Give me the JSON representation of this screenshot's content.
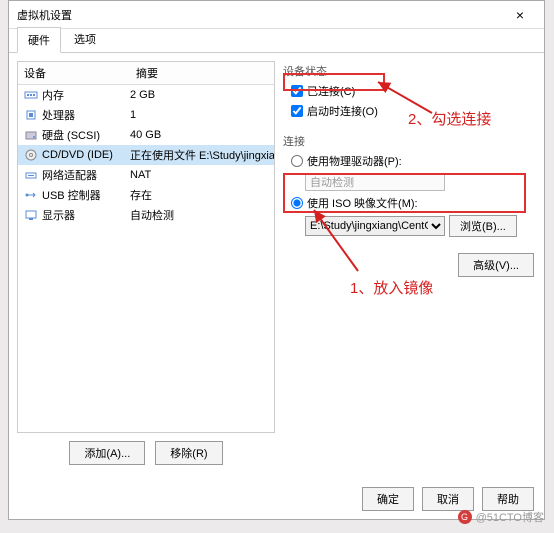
{
  "window": {
    "title": "虚拟机设置",
    "close": "×"
  },
  "tabs": {
    "hardware": "硬件",
    "options": "选项"
  },
  "table": {
    "col_device": "设备",
    "col_summary": "摘要",
    "rows": [
      {
        "name": "内存",
        "val": "2 GB"
      },
      {
        "name": "处理器",
        "val": "1"
      },
      {
        "name": "硬盘 (SCSI)",
        "val": "40 GB"
      },
      {
        "name": "CD/DVD (IDE)",
        "val": "正在使用文件 E:\\Study\\jingxian..."
      },
      {
        "name": "网络适配器",
        "val": "NAT"
      },
      {
        "name": "USB 控制器",
        "val": "存在"
      },
      {
        "name": "显示器",
        "val": "自动检测"
      }
    ]
  },
  "left_buttons": {
    "add": "添加(A)...",
    "remove": "移除(R)"
  },
  "right": {
    "status_title": "设备状态",
    "connected": "已连接(C)",
    "connect_at_power": "启动时连接(O)",
    "connection_title": "连接",
    "use_physical": "使用物理驱动器(P):",
    "physical_auto": "自动检测",
    "use_iso": "使用 ISO 映像文件(M):",
    "iso_path": "E:\\Study\\jingxiang\\CentOS-",
    "browse": "浏览(B)...",
    "advanced": "高级(V)..."
  },
  "footer": {
    "ok": "确定",
    "cancel": "取消",
    "help": "帮助"
  },
  "annotations": {
    "a1": "2、勾选连接",
    "a2": "1、放入镜像"
  },
  "watermark": "@51CTO博客"
}
